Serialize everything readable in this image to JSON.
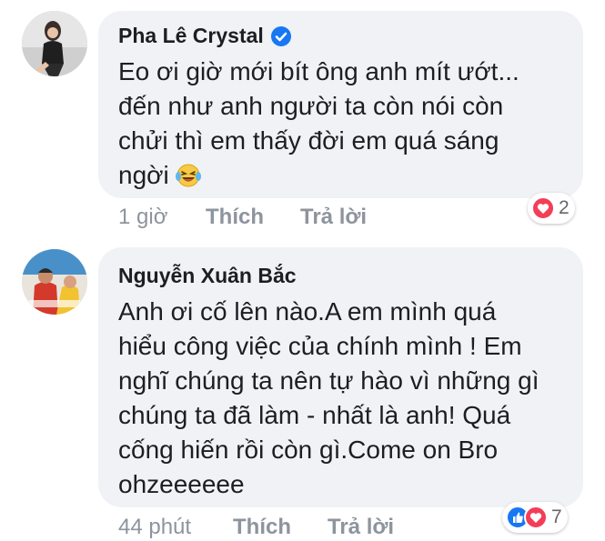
{
  "comments": [
    {
      "author": "Pha Lê Crystal",
      "verified": true,
      "text_lines": [
        "Eo ơi giờ mới bít ông anh mít ướt...",
        "đến như anh người ta còn nói còn",
        "chửi thì em thấy đời em quá sáng",
        "ngời"
      ],
      "emoji": "laughing-tears-icon",
      "time": "1 giờ",
      "like_label": "Thích",
      "reply_label": "Trả lời",
      "reactions": [
        "love-icon"
      ],
      "reaction_count": "2"
    },
    {
      "author": "Nguyễn Xuân Bắc",
      "verified": false,
      "text_lines": [
        "Anh ơi cố lên nào.A em mình quá",
        "hiểu công việc của chính mình ! Em",
        "nghĩ chúng ta nên tự hào vì những gì",
        "chúng ta đã làm - nhất là anh! Quá",
        "cống hiến rồi còn gì.Come on Bro",
        "ohzeeeeee"
      ],
      "time": "44 phút",
      "like_label": "Thích",
      "reply_label": "Trả lời",
      "reactions": [
        "like-icon",
        "love-icon"
      ],
      "reaction_count": "7"
    }
  ],
  "colors": {
    "bubble": "#f0f2f5",
    "meta": "#8d949e",
    "verified": "#1877f2",
    "love": "#f33e58",
    "like": "#1877f2"
  }
}
